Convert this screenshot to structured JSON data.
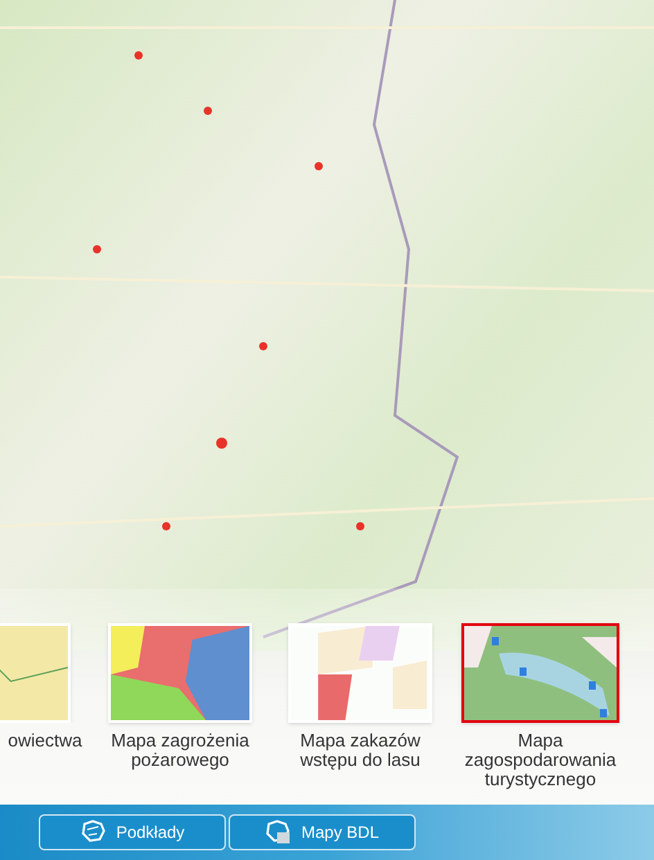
{
  "layers": [
    {
      "label": "owiectwa",
      "selected": false
    },
    {
      "label": "Mapa zagrożenia pożarowego",
      "selected": false
    },
    {
      "label": "Mapa zakazów wstępu do lasu",
      "selected": false
    },
    {
      "label": "Mapa zagospodarowania turystycznego",
      "selected": true
    }
  ],
  "buttons": [
    {
      "label": "Podkłady"
    },
    {
      "label": "Mapy BDL"
    }
  ]
}
